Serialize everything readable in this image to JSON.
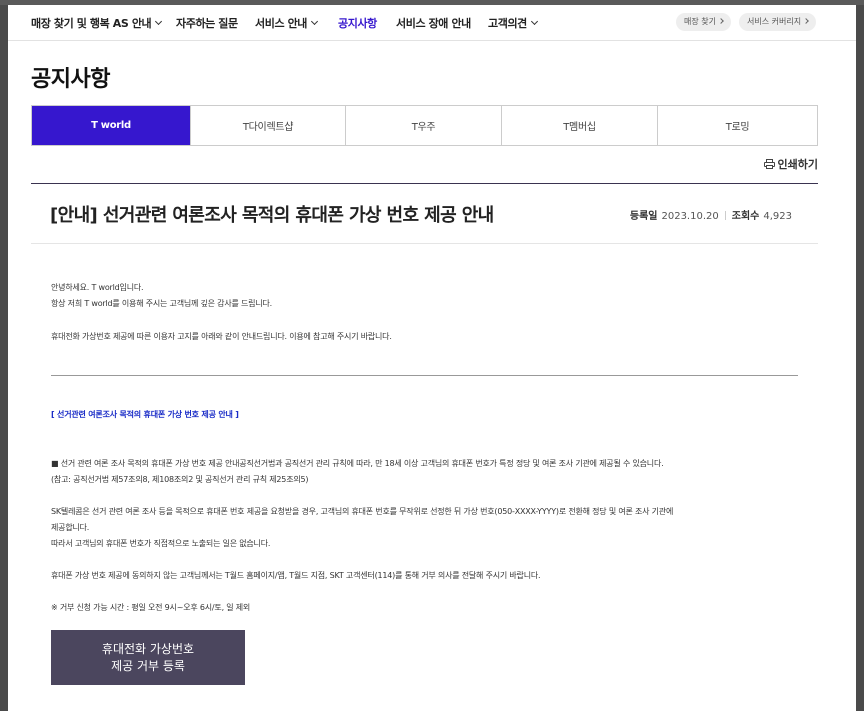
{
  "gnb": {
    "items": [
      {
        "label": "매장 찾기 및 행복 AS 안내",
        "dropdown": true
      },
      {
        "label": "자주하는 질문",
        "dropdown": false
      },
      {
        "label": "서비스 안내",
        "dropdown": true
      },
      {
        "label": "공지사항",
        "dropdown": false,
        "active": true
      },
      {
        "label": "서비스 장애 안내",
        "dropdown": false
      },
      {
        "label": "고객의견",
        "dropdown": true
      }
    ],
    "pills": [
      "매장 찾기",
      "서비스 커버리지"
    ]
  },
  "page_title": "공지사항",
  "tabs": [
    "T world",
    "T다이렉트샵",
    "T우주",
    "T멤버십",
    "T로밍"
  ],
  "active_tab": "T world",
  "print_label": "인쇄하기",
  "article": {
    "title": "[안내] 선거관련 여론조사 목적의 휴대폰 가상 번호 제공 안내",
    "date_label": "등록일",
    "date": "2023.10.20",
    "views_label": "조회수",
    "views": "4,923"
  },
  "body": {
    "intro1": "안녕하세요. T world입니다.",
    "intro2": "항상 저희 T world를 이용해 주시는 고객님께 깊은 감사를 드립니다.",
    "intro3": "휴대전화 가상번호 제공에 따른 이용자 고지를 아래와 같이 안내드립니다. 이용에 참고해 주시기 바랍니다.",
    "section_title": "[ 선거관련 여론조사 목적의 휴대폰 가상 번호 제공 안내 ]",
    "p1a": "■ 선거 관련 여론 조사 목적의 휴대폰 가상 번호 제공 안내공직선거법과 공직선거 관리 규칙에 따라, 만 18세 이상 고객님의 휴대폰 번호가 특정 정당 및 여론 조사 기관에 제공될 수 있습니다.",
    "p1b": "(참고: 공직선거법 제57조의8, 제108조의2 및 공직선거 관리 규칙 제25조의5)",
    "p2a": "SK텔레콤은 선거 관련 여론 조사 등을 목적으로 휴대폰 번호 제공을 요청받을 경우, 고객님의 휴대폰 번호를 무작위로 선정한 뒤 가상 번호(050-XXXX-YYYY)로 전환해 정당 및 여론 조사 기관에",
    "p2b": "제공합니다.",
    "p2c": "따라서 고객님의 휴대폰 번호가 직접적으로 노출되는 일은 없습니다.",
    "p3": "휴대폰 가상 번호 제공에 동의하지 않는 고객님께서는 T월드 홈페이지/앱, T월드 지점, SKT 고객센터(114)를 통해 거부 의사를 전달해 주시기 바랍니다.",
    "note": "※ 거부 신청 가능 시간 : 평일 오전 9시~오후 6시/토, 일 제외"
  },
  "cta": {
    "line1": "휴대전화 가상번호",
    "line2": "제공 거부 등록"
  },
  "colors": {
    "accent": "#3617ce",
    "cta_bg": "#4b465e",
    "section_blue": "#1a2cc7"
  }
}
